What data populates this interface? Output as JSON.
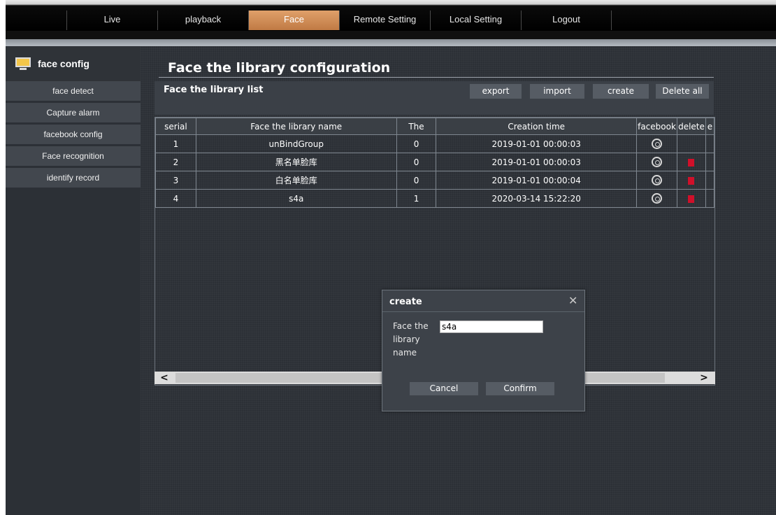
{
  "nav": {
    "items": [
      "Live",
      "playback",
      "Face",
      "Remote Setting",
      "Local Setting",
      "Logout"
    ],
    "active": "Face",
    "active_color": "#d08a52"
  },
  "sidebar": {
    "title": "face config",
    "items": [
      "face detect",
      "Capture alarm",
      "facebook config",
      "Face recognition",
      "identify record"
    ]
  },
  "page": {
    "title": "Face the library configuration",
    "panel_title": "Face the library list",
    "buttons": {
      "export": "export",
      "import": "import",
      "create": "create",
      "delete_all": "Delete all"
    }
  },
  "table": {
    "headers": [
      "serial",
      "Face the library name",
      "The",
      "Creation time",
      "facebook",
      "delete",
      "e"
    ],
    "rows": [
      {
        "serial": "1",
        "name": "unBindGroup",
        "count": "0",
        "time": "2019-01-01 00:00:03",
        "has_delete": false
      },
      {
        "serial": "2",
        "name": "黑名单脸库",
        "count": "0",
        "time": "2019-01-01 00:00:03",
        "has_delete": true
      },
      {
        "serial": "3",
        "name": "白名单脸库",
        "count": "0",
        "time": "2019-01-01 00:00:04",
        "has_delete": true
      },
      {
        "serial": "4",
        "name": "s4a",
        "count": "1",
        "time": "2020-03-14 15:22:20",
        "has_delete": true
      }
    ],
    "scroll_left": "<",
    "scroll_right": ">"
  },
  "dialog": {
    "title": "create",
    "close": "✕",
    "field_label": "Face the library name",
    "field_value": "s4a",
    "cancel": "Cancel",
    "confirm": "Confirm"
  },
  "colors": {
    "delete_icon": "#d0102a",
    "panel_bg": "#2c3036"
  }
}
